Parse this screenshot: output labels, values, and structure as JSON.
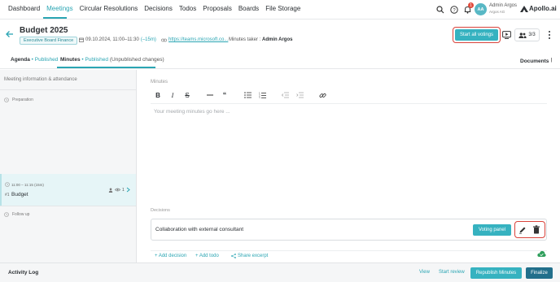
{
  "nav": {
    "items": [
      "Dashboard",
      "Meetings",
      "Circular Resolutions",
      "Decisions",
      "Todos",
      "Proposals",
      "Boards",
      "File Storage"
    ],
    "active": "Meetings",
    "notification_count": "1",
    "user": {
      "initials": "AA",
      "name": "Admin Argos",
      "org": "Argos AG"
    },
    "brand": "Apollo.ai"
  },
  "meeting": {
    "title": "Budget 2025",
    "tag": "Executive Board Finance",
    "date": "09.10.2024, 11:00–11:30",
    "duration": "(–15m)",
    "link": "https://teams.microsoft.co...",
    "minutes_taker_label": "Minutes taker :",
    "minutes_taker": "Admin Argos",
    "start_voting_label": "Start all votings",
    "attendees": "3/3"
  },
  "tabs": {
    "agenda": {
      "label": "Agenda",
      "status": "Published"
    },
    "minutes": {
      "label": "Minutes",
      "status": "Published",
      "note": "(Unpublished changes)"
    },
    "documents": "Documents"
  },
  "sidebar": {
    "header": "Meeting information & attendance",
    "preparation": "Preparation",
    "agenda_item": {
      "time": "11:00 – 11:15 (15m)",
      "number": "#1",
      "title": "Budget",
      "count": "1"
    },
    "follow_up": "Follow up"
  },
  "main": {
    "minutes_label": "Minutes",
    "placeholder": "Your meeting minutes go here ...",
    "decisions_label": "Decisions",
    "decision": {
      "text": "Collaboration with external consultant",
      "voting_panel_label": "Voting panel"
    },
    "actions": {
      "add_decision": "+ Add decision",
      "add_todo": "+ Add todo",
      "share_excerpt": "Share excerpt"
    }
  },
  "bottom": {
    "activity_log": "Activity Log",
    "view": "View",
    "start_review": "Start review",
    "republish": "Republish Minutes",
    "finalize": "Finalize"
  },
  "colors": {
    "accent": "#36b2c0",
    "highlight": "#d9423a",
    "finalize": "#226f8b"
  }
}
